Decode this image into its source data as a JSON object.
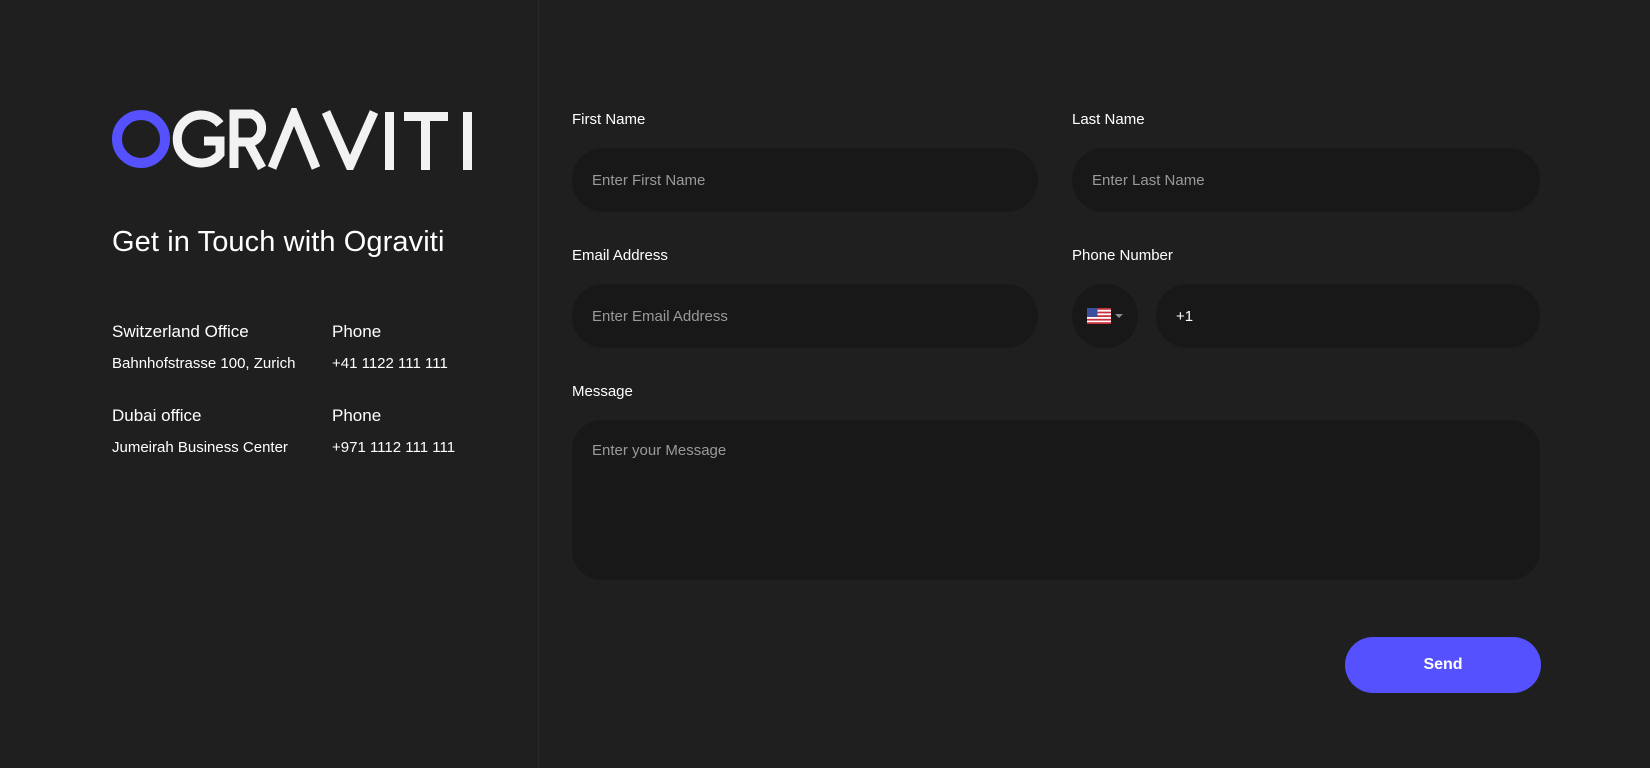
{
  "brand": {
    "logo_text": "OGRAVITI",
    "accent_color": "#5551ff"
  },
  "contact": {
    "heading": "Get in Touch with Ograviti",
    "offices": [
      {
        "title": "Switzerland Office",
        "address": "Bahnhofstrasse 100, Zurich",
        "phone_label": "Phone",
        "phone": "+41 1122 111 111"
      },
      {
        "title": "Dubai office",
        "address": "Jumeirah Business Center",
        "phone_label": "Phone",
        "phone": "+971 1112 111 111"
      }
    ]
  },
  "form": {
    "first_name": {
      "label": "First Name",
      "placeholder": "Enter First Name",
      "value": ""
    },
    "last_name": {
      "label": "Last Name",
      "placeholder": "Enter Last Name",
      "value": ""
    },
    "email": {
      "label": "Email Address",
      "placeholder": "Enter Email Address",
      "value": ""
    },
    "phone": {
      "label": "Phone Number",
      "country_icon": "us-flag-icon",
      "value": "+1"
    },
    "message": {
      "label": "Message",
      "placeholder": "Enter your Message",
      "value": ""
    },
    "send_label": "Send"
  }
}
